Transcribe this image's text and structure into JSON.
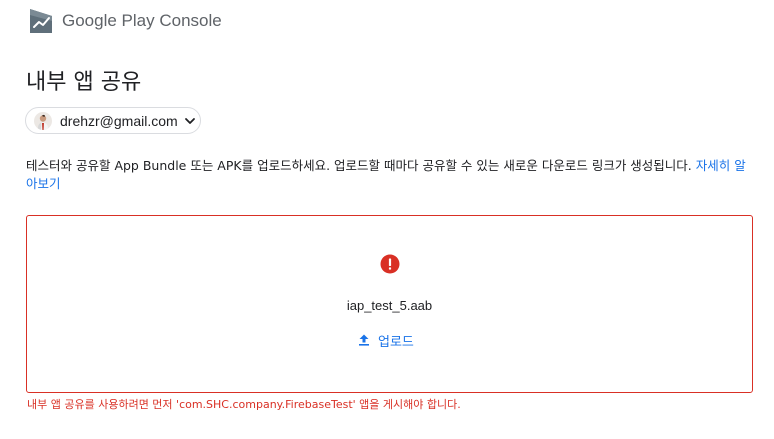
{
  "header": {
    "brand_google": "Google Play",
    "brand_product": " Console",
    "logo_icon": "google-play-console-logo-icon"
  },
  "page": {
    "title": "내부 앱 공유"
  },
  "account": {
    "email": "drehzr@gmail.com",
    "avatar_icon": "user-avatar",
    "dropdown_icon": "chevron-down-icon"
  },
  "description": {
    "text": "테스터와 공유할 App Bundle 또는 APK를 업로드하세요. 업로드할 때마다 공유할 수 있는 새로운 다운로드 링크가 생성됩니다. ",
    "link_text": "자세히 알아보기"
  },
  "upload": {
    "status_icon": "error-icon",
    "file_name": "iap_test_5.aab",
    "button_label": "업로드",
    "button_icon": "upload-icon"
  },
  "error": {
    "message": "내부 앱 공유를 사용하려면 먼저 'com.SHC.company.FirebaseTest' 앱을 게시해야 합니다."
  },
  "colors": {
    "accent": "#1a73e8",
    "error": "#d93025",
    "border": "#dadce0",
    "text": "#202124",
    "brand_text": "#5f6368"
  }
}
